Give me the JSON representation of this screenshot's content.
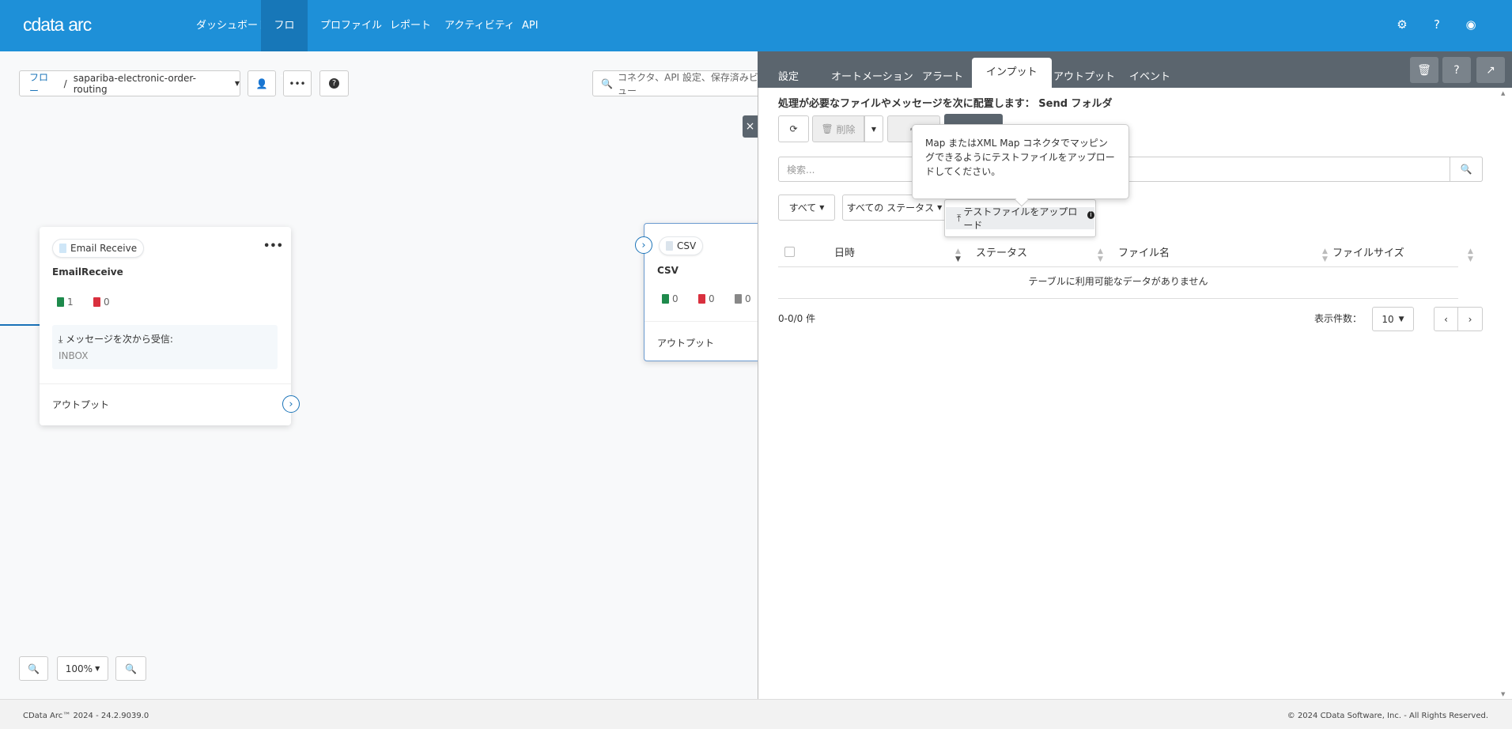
{
  "header": {
    "logo": "cdata",
    "logo_suffix": "arc",
    "nav": [
      "ダッシュボード",
      "フロー",
      "プロファイル",
      "レポート",
      "アクティビティ",
      "API"
    ],
    "active_nav": "フロー",
    "icons": [
      "gear-icon",
      "help-icon",
      "user-icon"
    ]
  },
  "toolbar": {
    "breadcrumb_root": "フロー",
    "separator": "/",
    "flow_name": "sapariba-electronic-order-routing",
    "search_placeholder": "コネクタ、API 設定、保存済みビュー"
  },
  "canvas": {
    "email_card": {
      "type": "Email Receive",
      "name": "EmailReceive",
      "success": "1",
      "error": "0",
      "receive_label": "メッセージを次から受信:",
      "folder": "INBOX",
      "output": "アウトプット"
    },
    "csv_card": {
      "type": "CSV",
      "name": "CSV",
      "success": "0",
      "error": "0",
      "pending": "0",
      "output": "アウトプット"
    },
    "zoom_level": "100%"
  },
  "panel": {
    "tabs": [
      "設定",
      "オートメーション",
      "アラート",
      "インプット",
      "アウトプット",
      "イベント"
    ],
    "active_tab": "インプット",
    "info_prefix": "処理が必要なファイルやメッセージを次に配置します：",
    "info_folder": "Send フォルダ",
    "delete_label": "削除",
    "tooltip": "Map またはXML Map コネクタでマッピングできるようにテストファイルをアップロードしてください。",
    "search_placeholder": "検索...",
    "filter_all": "すべて",
    "filter_status": "すべての ステータス",
    "upload_menu_item": "テストファイルをアップロード",
    "columns": [
      "日時",
      "ステータス",
      "ファイル名",
      "ファイルサイズ"
    ],
    "empty_text": "テーブルに利用可能なデータがありません",
    "count_text": "0-0/0 件",
    "page_size_label": "表示件数：",
    "page_size": "10"
  },
  "footer": {
    "left": "CData Arc™ 2024 - 24.2.9039.0",
    "right": "© 2024 CData Software, Inc. - All Rights Reserved."
  }
}
